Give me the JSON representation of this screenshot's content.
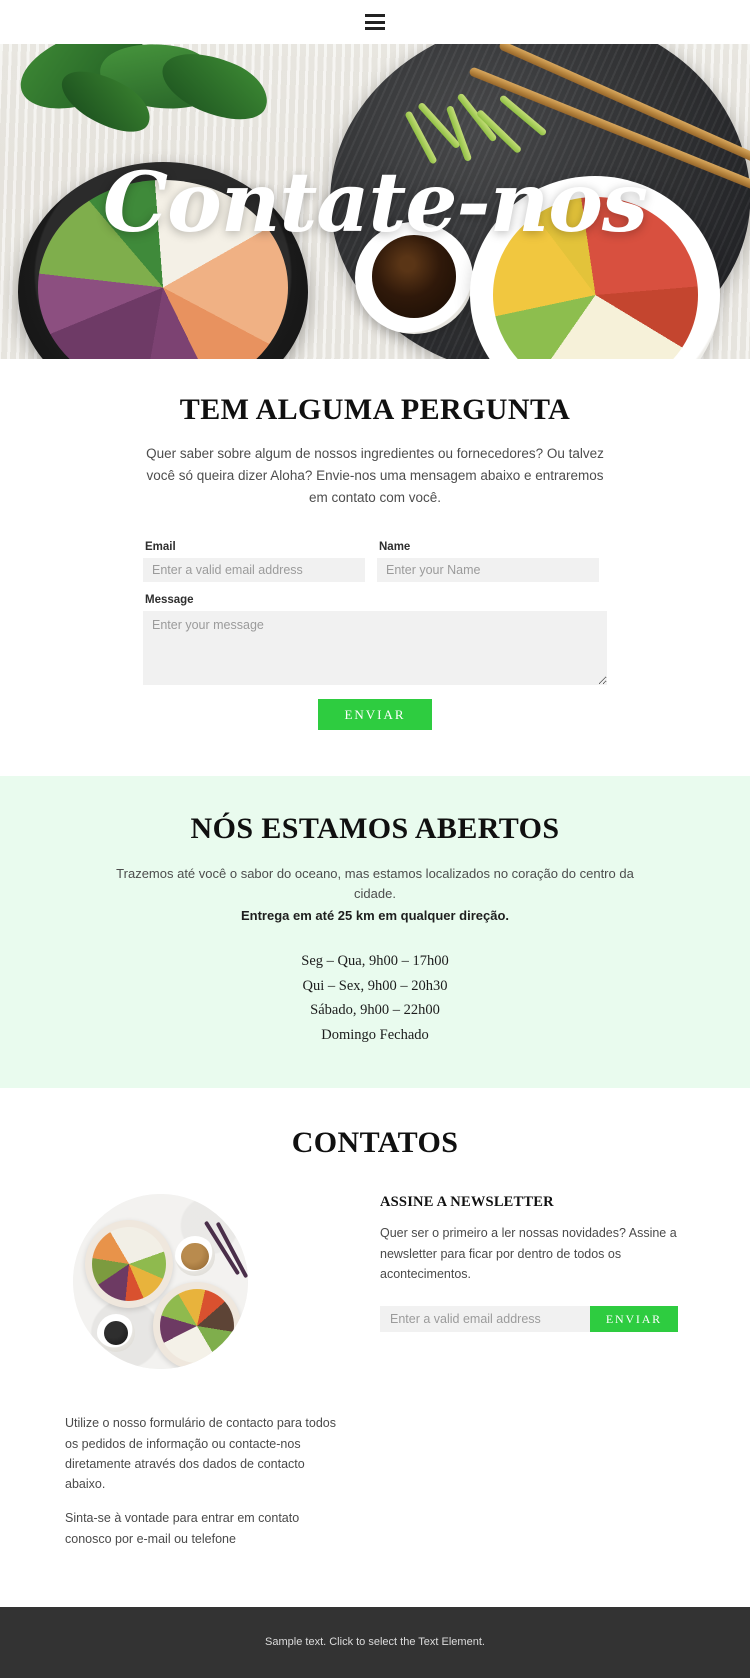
{
  "topbar": {
    "menu_icon": "hamburger-icon"
  },
  "hero": {
    "title": "Contate-nos"
  },
  "question": {
    "heading": "TEM ALGUMA PERGUNTA",
    "lead": "Quer saber sobre algum de nossos ingredientes ou fornecedores? Ou talvez você só queira dizer Aloha? Envie-nos uma mensagem abaixo e entraremos em contato com você.",
    "form": {
      "email_label": "Email",
      "email_placeholder": "Enter a valid email address",
      "email_value": "",
      "name_label": "Name",
      "name_placeholder": "Enter your Name",
      "name_value": "",
      "message_label": "Message",
      "message_placeholder": "Enter your message",
      "message_value": "",
      "submit_label": "ENVIAR"
    }
  },
  "open": {
    "heading": "NÓS ESTAMOS ABERTOS",
    "line1": "Trazemos até você o sabor do oceano, mas estamos localizados no coração do centro da cidade.",
    "line2": "Entrega em até 25 km em qualquer direção.",
    "hours": [
      "Seg – Qua, 9h00 – 17h00",
      "Qui – Sex, 9h00 – 20h30",
      "Sábado, 9h00 – 22h00",
      "Domingo Fechado"
    ]
  },
  "contatos": {
    "heading": "CONTATOS",
    "left": {
      "image_name": "poke-bowls-photo",
      "para1": "Utilize o nosso formulário de contacto para todos os pedidos de informação ou contacte-nos diretamente através dos dados de contacto abaixo.",
      "para2": "Sinta-se à vontade para entrar em contato conosco por e-mail ou telefone"
    },
    "newsletter": {
      "heading": "ASSINE A NEWSLETTER",
      "text": "Quer ser o primeiro a ler nossas novidades? Assine a newsletter para ficar por dentro de todos os acontecimentos.",
      "email_placeholder": "Enter a valid email address",
      "email_value": "",
      "submit_label": "ENVIAR"
    }
  },
  "footer": {
    "text": "Sample text. Click to select the Text Element."
  },
  "colors": {
    "accent_green": "#2ecc40",
    "section_green_bg": "#e9fbee",
    "footer_bg": "#333333",
    "input_bg": "#f1f1f1"
  }
}
